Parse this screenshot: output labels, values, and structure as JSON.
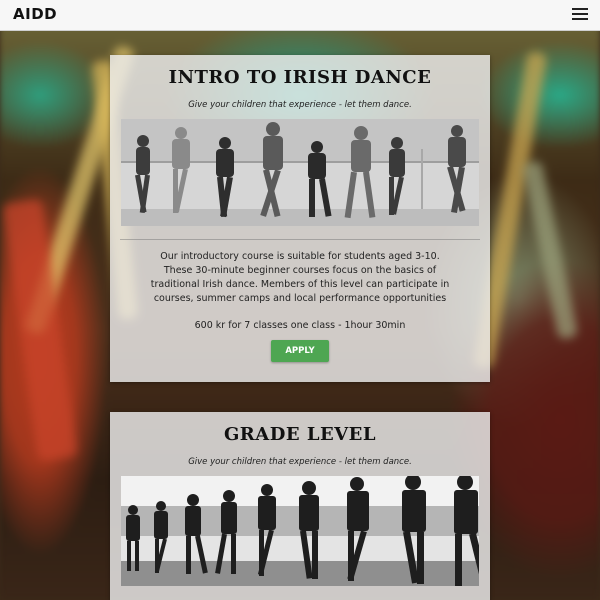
{
  "header": {
    "brand": "AIDD",
    "menu_icon": "hamburger-menu-icon"
  },
  "courses": [
    {
      "title": "INTRO TO IRISH DANCE",
      "tagline": "Give your children that experience - let them dance.",
      "description": "Our introductory course is suitable for students aged 3-10. These 30-minute beginner courses focus on the basics of traditional Irish dance. Members of this level can participate in courses, summer camps and local performance opportunities",
      "price": "600 kr for 7 classes one class - 1hour 30min",
      "apply_label": "APPLY"
    },
    {
      "title": "GRADE LEVEL",
      "tagline": "Give your children that experience - let them dance."
    }
  ],
  "colors": {
    "apply_button": "#4ea652",
    "card_background": "#eeeeee",
    "topbar_background": "#f7f7f7"
  }
}
